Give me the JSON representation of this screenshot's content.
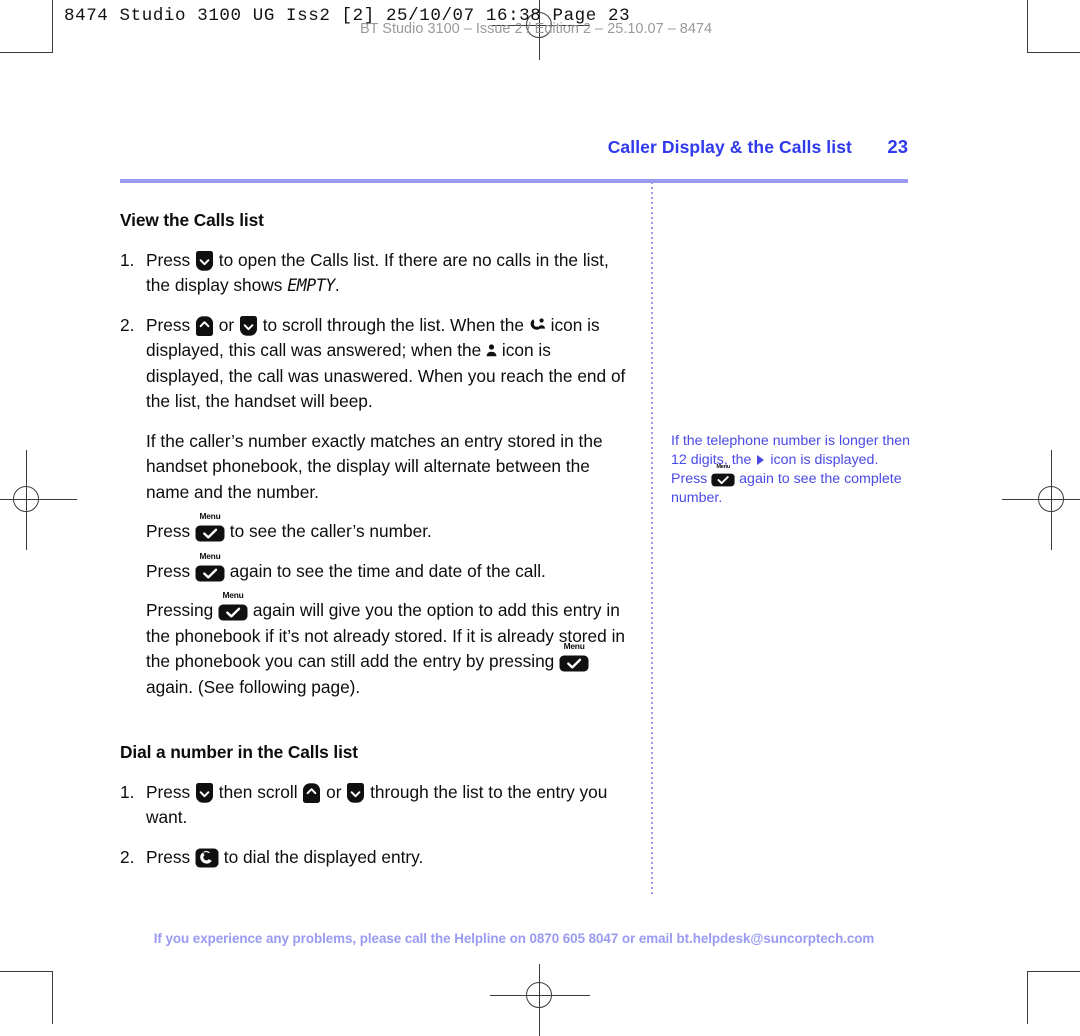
{
  "prepress": {
    "job_line": "8474 Studio 3100 UG Iss2 [2]  25/10/07  16:38  Page 23",
    "faint_line": "BT Studio 3100 – Issue 2 / Edition 2 – 25.10.07 – 8474"
  },
  "running_head": {
    "title": "Caller Display & the Calls list",
    "page_number": "23",
    "rule_color": "#9a9af2",
    "text_color": "#2f3aec"
  },
  "sections": {
    "view": {
      "heading": "View the Calls list",
      "items": [
        {
          "number": "1.",
          "parts": [
            {
              "t": "text",
              "v": "Press "
            },
            {
              "t": "icon",
              "v": "down-key-icon"
            },
            {
              "t": "text",
              "v": " to open the Calls list. If there are no calls in the list, the display shows "
            },
            {
              "t": "lcd",
              "v": "EMPTY"
            },
            {
              "t": "text",
              "v": "."
            }
          ]
        },
        {
          "number": "2.",
          "parts": [
            {
              "t": "text",
              "v": "Press "
            },
            {
              "t": "icon",
              "v": "up-key-icon"
            },
            {
              "t": "text",
              "v": " or "
            },
            {
              "t": "icon",
              "v": "down-key-icon"
            },
            {
              "t": "text",
              "v": " to scroll through the list. When the "
            },
            {
              "t": "icon",
              "v": "answered-call-icon"
            },
            {
              "t": "text",
              "v": " icon is displayed, this call was answered; when the "
            },
            {
              "t": "icon",
              "v": "unanswered-call-icon"
            },
            {
              "t": "text",
              "v": " icon is displayed, the call was unaswered. When you reach the end of the list, the handset will beep."
            }
          ]
        }
      ],
      "paragraphs": [
        {
          "parts": [
            {
              "t": "text",
              "v": "If the caller’s number exactly matches an entry stored in the handset phonebook, the display will alternate between the name and the number."
            }
          ]
        },
        {
          "parts": [
            {
              "t": "text",
              "v": "Press "
            },
            {
              "t": "menukey",
              "v": "Menu"
            },
            {
              "t": "text",
              "v": " to see the caller’s number."
            }
          ]
        },
        {
          "parts": [
            {
              "t": "text",
              "v": "Press "
            },
            {
              "t": "menukey",
              "v": "Menu"
            },
            {
              "t": "text",
              "v": " again to see the time and date of the call."
            }
          ]
        },
        {
          "parts": [
            {
              "t": "text",
              "v": "Pressing "
            },
            {
              "t": "menukey",
              "v": "Menu"
            },
            {
              "t": "text",
              "v": " again will give you the option to add this entry in the phonebook if it’s not already stored. If it is already stored in the phonebook you can still add the entry by pressing "
            },
            {
              "t": "menukey",
              "v": "Menu"
            },
            {
              "t": "text",
              "v": " again. (See following page)."
            }
          ]
        }
      ]
    },
    "dial": {
      "heading": "Dial a number in the Calls list",
      "items": [
        {
          "number": "1.",
          "parts": [
            {
              "t": "text",
              "v": "Press "
            },
            {
              "t": "icon",
              "v": "down-key-icon"
            },
            {
              "t": "text",
              "v": " then scroll "
            },
            {
              "t": "icon",
              "v": "up-key-icon"
            },
            {
              "t": "text",
              "v": " or "
            },
            {
              "t": "icon",
              "v": "down-key-icon"
            },
            {
              "t": "text",
              "v": " through the list to the entry you want."
            }
          ]
        },
        {
          "number": "2.",
          "parts": [
            {
              "t": "text",
              "v": "Press "
            },
            {
              "t": "icon",
              "v": "dial-key-icon"
            },
            {
              "t": "text",
              "v": " to dial the displayed entry."
            }
          ]
        }
      ]
    }
  },
  "side_note": {
    "parts": [
      {
        "t": "text",
        "v": "If the telephone number is longer then 12 digits, the "
      },
      {
        "t": "icon",
        "v": "right-arrow-icon"
      },
      {
        "t": "text",
        "v": " icon is displayed. Press "
      },
      {
        "t": "menukey",
        "v": "Menu"
      },
      {
        "t": "text",
        "v": " again to see the complete number."
      }
    ],
    "color": "#4a4ae6"
  },
  "footer": {
    "text": "If you experience any problems, please call the Helpline on 0870 605 8047 or email bt.helpdesk@suncorptech.com",
    "color": "#9a9af2"
  }
}
